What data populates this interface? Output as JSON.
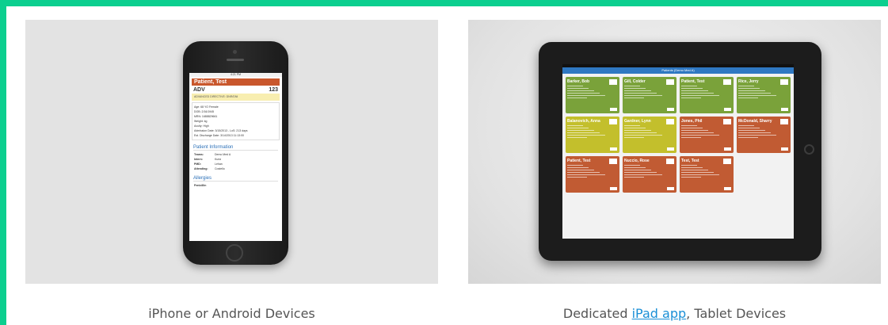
{
  "panels": {
    "left": {
      "caption": "iPhone or Android Devices"
    },
    "right": {
      "caption_prefix": "Dedicated ",
      "caption_link": "iPad app",
      "caption_suffix": ", Tablet Devices"
    }
  },
  "phone": {
    "status_time": "4:21 PM",
    "patient_name": "Patient, Test",
    "code": "ADV",
    "code_number": "123",
    "advance_directive": "ADVANCED DIRECTIVE: DNR/DNI",
    "info_lines": [
      "Age: 68 YO Female",
      "DOB: 2/16/1945",
      "MRN: 1688829661",
      "Weight: kg",
      "Acuity: High",
      "Admission Date: 3/15/2013 - LoS: 213 days",
      "Est. Discharge Date: 3/14/2013 11:13:00"
    ],
    "section_title": "Patient Information",
    "fields": [
      {
        "key": "Teams:",
        "value": "Demo Med A"
      },
      {
        "key": "Intern:",
        "value": "Kurtz"
      },
      {
        "key": "PMD:",
        "value": "Lehan"
      },
      {
        "key": "Attending:",
        "value": "Costello"
      }
    ],
    "allergies_title": "Allergies",
    "allergy_item": "Penicillin"
  },
  "tablet": {
    "nav_title": "Patients (Demo Med A)",
    "cards": [
      {
        "name": "Barker, Bob",
        "color": "#7aa23a"
      },
      {
        "name": "Gill, Colder",
        "color": "#7aa23a"
      },
      {
        "name": "Patient, Test",
        "color": "#7aa23a"
      },
      {
        "name": "Rice, Jerry",
        "color": "#7aa23a"
      },
      {
        "name": "Balanovich, Anna",
        "color": "#c3bf2c"
      },
      {
        "name": "Gardner, Lynn",
        "color": "#c3bf2c"
      },
      {
        "name": "Jones, Phil",
        "color": "#c15b33"
      },
      {
        "name": "McDonald, Sharry",
        "color": "#c15b33"
      },
      {
        "name": "Patient, Test",
        "color": "#c15b33"
      },
      {
        "name": "Nuccio, Rose",
        "color": "#c15b33"
      },
      {
        "name": "Test, Test",
        "color": "#c15b33"
      }
    ]
  }
}
